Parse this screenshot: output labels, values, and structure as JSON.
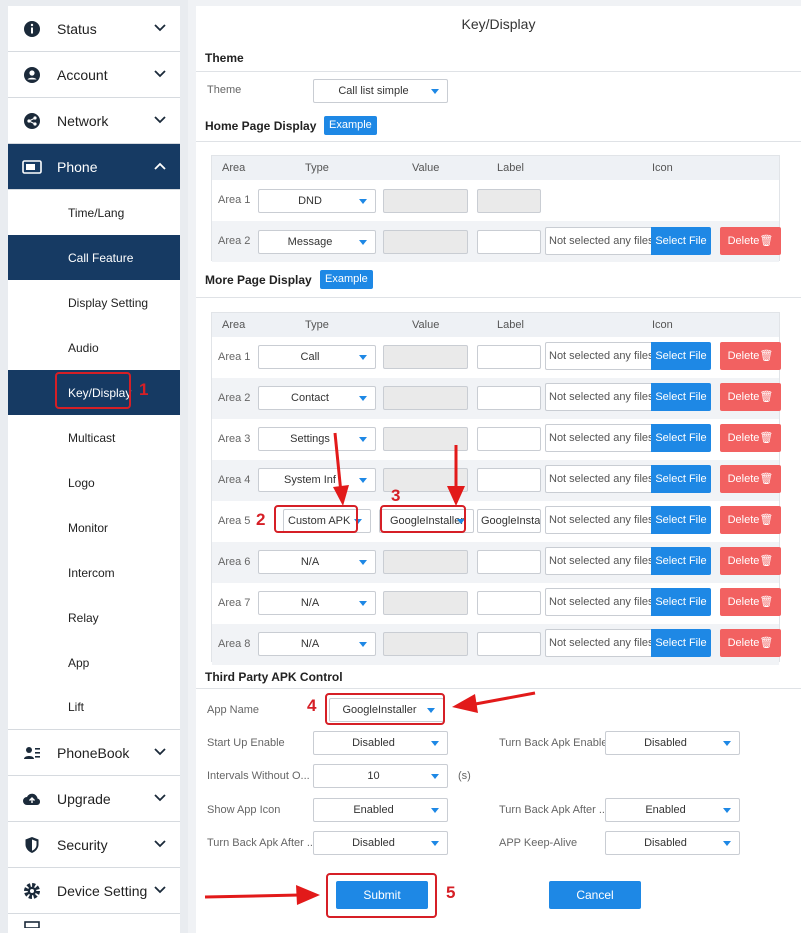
{
  "sidebar": {
    "top": [
      {
        "label": "Status",
        "icon": "info-icon"
      },
      {
        "label": "Account",
        "icon": "user-icon"
      },
      {
        "label": "Network",
        "icon": "share-icon"
      },
      {
        "label": "Phone",
        "icon": "phone-screen-icon"
      }
    ],
    "phone_sub": [
      "Time/Lang",
      "Call Feature",
      "Display Setting",
      "Audio",
      "Key/Display",
      "Multicast",
      "Logo",
      "Monitor",
      "Intercom",
      "Relay",
      "App",
      "Lift"
    ],
    "bottom": [
      {
        "label": "PhoneBook",
        "icon": "phonebook-icon"
      },
      {
        "label": "Upgrade",
        "icon": "cloud-upload-icon"
      },
      {
        "label": "Security",
        "icon": "shield-icon"
      },
      {
        "label": "Device Setting",
        "icon": "gear-icon"
      }
    ]
  },
  "page": {
    "title": "Key/Display"
  },
  "theme": {
    "section": "Theme",
    "label": "Theme",
    "value": "Call list simple"
  },
  "home": {
    "section": "Home Page Display",
    "example": "Example",
    "headers": {
      "area": "Area",
      "type": "Type",
      "value": "Value",
      "label": "Label",
      "icon": "Icon"
    },
    "rows": [
      {
        "area": "Area 1",
        "type": "DND"
      },
      {
        "area": "Area 2",
        "type": "Message",
        "file": "Not selected any files",
        "select": "Select File",
        "del": "Delete"
      }
    ]
  },
  "more": {
    "section": "More Page Display",
    "example": "Example",
    "headers": {
      "area": "Area",
      "type": "Type",
      "value": "Value",
      "label": "Label",
      "icon": "Icon"
    },
    "rows": [
      {
        "area": "Area 1",
        "type": "Call",
        "value": "",
        "label": ""
      },
      {
        "area": "Area 2",
        "type": "Contact",
        "value": "",
        "label": ""
      },
      {
        "area": "Area 3",
        "type": "Settings",
        "value": "",
        "label": ""
      },
      {
        "area": "Area 4",
        "type": "System Inf",
        "value": "",
        "label": ""
      },
      {
        "area": "Area 5",
        "type": "Custom APK",
        "value": "GoogleInstaller",
        "label": "GoogleInstal"
      },
      {
        "area": "Area 6",
        "type": "N/A",
        "value": "",
        "label": ""
      },
      {
        "area": "Area 7",
        "type": "N/A",
        "value": "",
        "label": ""
      },
      {
        "area": "Area 8",
        "type": "N/A",
        "value": "",
        "label": ""
      }
    ],
    "file": "Not selected any files",
    "select": "Select File",
    "del": "Delete"
  },
  "third": {
    "section": "Third Party APK Control",
    "app_name_label": "App Name",
    "app_name": "GoogleInstaller",
    "startup_label": "Start Up Enable",
    "startup": "Disabled",
    "turnback_enable_label": "Turn Back Apk Enable",
    "turnback_enable": "Disabled",
    "intervals_label": "Intervals Without O...",
    "intervals": "10",
    "intervals_unit": "(s)",
    "show_icon_label": "Show App Icon",
    "show_icon": "Enabled",
    "turnback_after1_label": "Turn Back Apk After ...",
    "turnback_after1": "Enabled",
    "turnback_after2_label": "Turn Back Apk After ...",
    "turnback_after2": "Disabled",
    "keepalive_label": "APP Keep-Alive",
    "keepalive": "Disabled"
  },
  "actions": {
    "submit": "Submit",
    "cancel": "Cancel"
  },
  "annotations": [
    "1",
    "2",
    "3",
    "4",
    "5"
  ],
  "colors": {
    "nav_active": "#163a63",
    "primary": "#1e88e5",
    "delete": "#f26161",
    "annotation": "#d61f26"
  }
}
